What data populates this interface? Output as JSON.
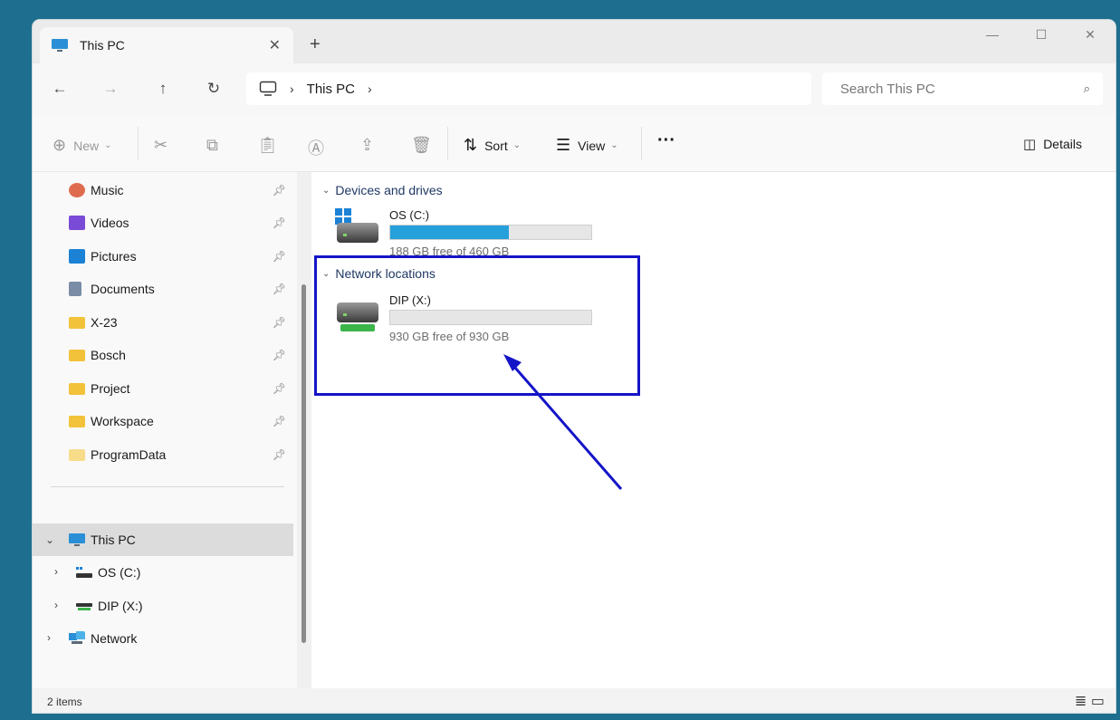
{
  "window": {
    "tab_title": "This PC",
    "tab_close": "✕",
    "new_tab": "+",
    "minimize": "—",
    "maximize": "☐",
    "close": "✕"
  },
  "nav": {
    "back": "←",
    "forward": "→",
    "up": "↑",
    "refresh": "↻",
    "breadcrumb": [
      "This PC"
    ],
    "search_placeholder": "Search This PC"
  },
  "toolbar": {
    "new_label": "New",
    "sort_label": "Sort",
    "view_label": "View",
    "more_label": "···",
    "details_label": "Details"
  },
  "sidebar": {
    "pinned": [
      {
        "label": "Music",
        "icon": "music-icon",
        "color": "#e06c50"
      },
      {
        "label": "Videos",
        "icon": "videos-icon",
        "color": "#7a4bd6"
      },
      {
        "label": "Pictures",
        "icon": "pictures-icon",
        "color": "#1b82d6"
      },
      {
        "label": "Documents",
        "icon": "documents-icon",
        "color": "#7a8ca6"
      },
      {
        "label": "X-23",
        "icon": "folder-icon",
        "color": "#f2c23a"
      },
      {
        "label": "Bosch",
        "icon": "folder-icon",
        "color": "#f2c23a"
      },
      {
        "label": "Project",
        "icon": "folder-icon",
        "color": "#f2c23a"
      },
      {
        "label": "Workspace",
        "icon": "folder-icon",
        "color": "#f2c23a"
      },
      {
        "label": "ProgramData",
        "icon": "folder-icon",
        "color": "#f7dc8a"
      }
    ],
    "tree": [
      {
        "label": "This PC",
        "icon": "this-pc-icon"
      },
      {
        "label": "OS (C:)",
        "icon": "drive-c-icon"
      },
      {
        "label": "DIP (X:)",
        "icon": "network-drive-icon"
      },
      {
        "label": "Network",
        "icon": "network-icon"
      }
    ]
  },
  "content": {
    "groups": [
      {
        "label": "Devices and drives"
      },
      {
        "label": "Network locations"
      }
    ],
    "drives": [
      {
        "name": "OS (C:)",
        "free_text": "188 GB free of 460 GB",
        "used_fraction": 0.59
      },
      {
        "name": "DIP (X:)",
        "free_text": "930 GB free of 930 GB",
        "used_fraction": 0.0
      }
    ]
  },
  "status": {
    "items": "2 items"
  },
  "colors": {
    "accent": "#26a0da",
    "highlight": "#1414c8"
  }
}
